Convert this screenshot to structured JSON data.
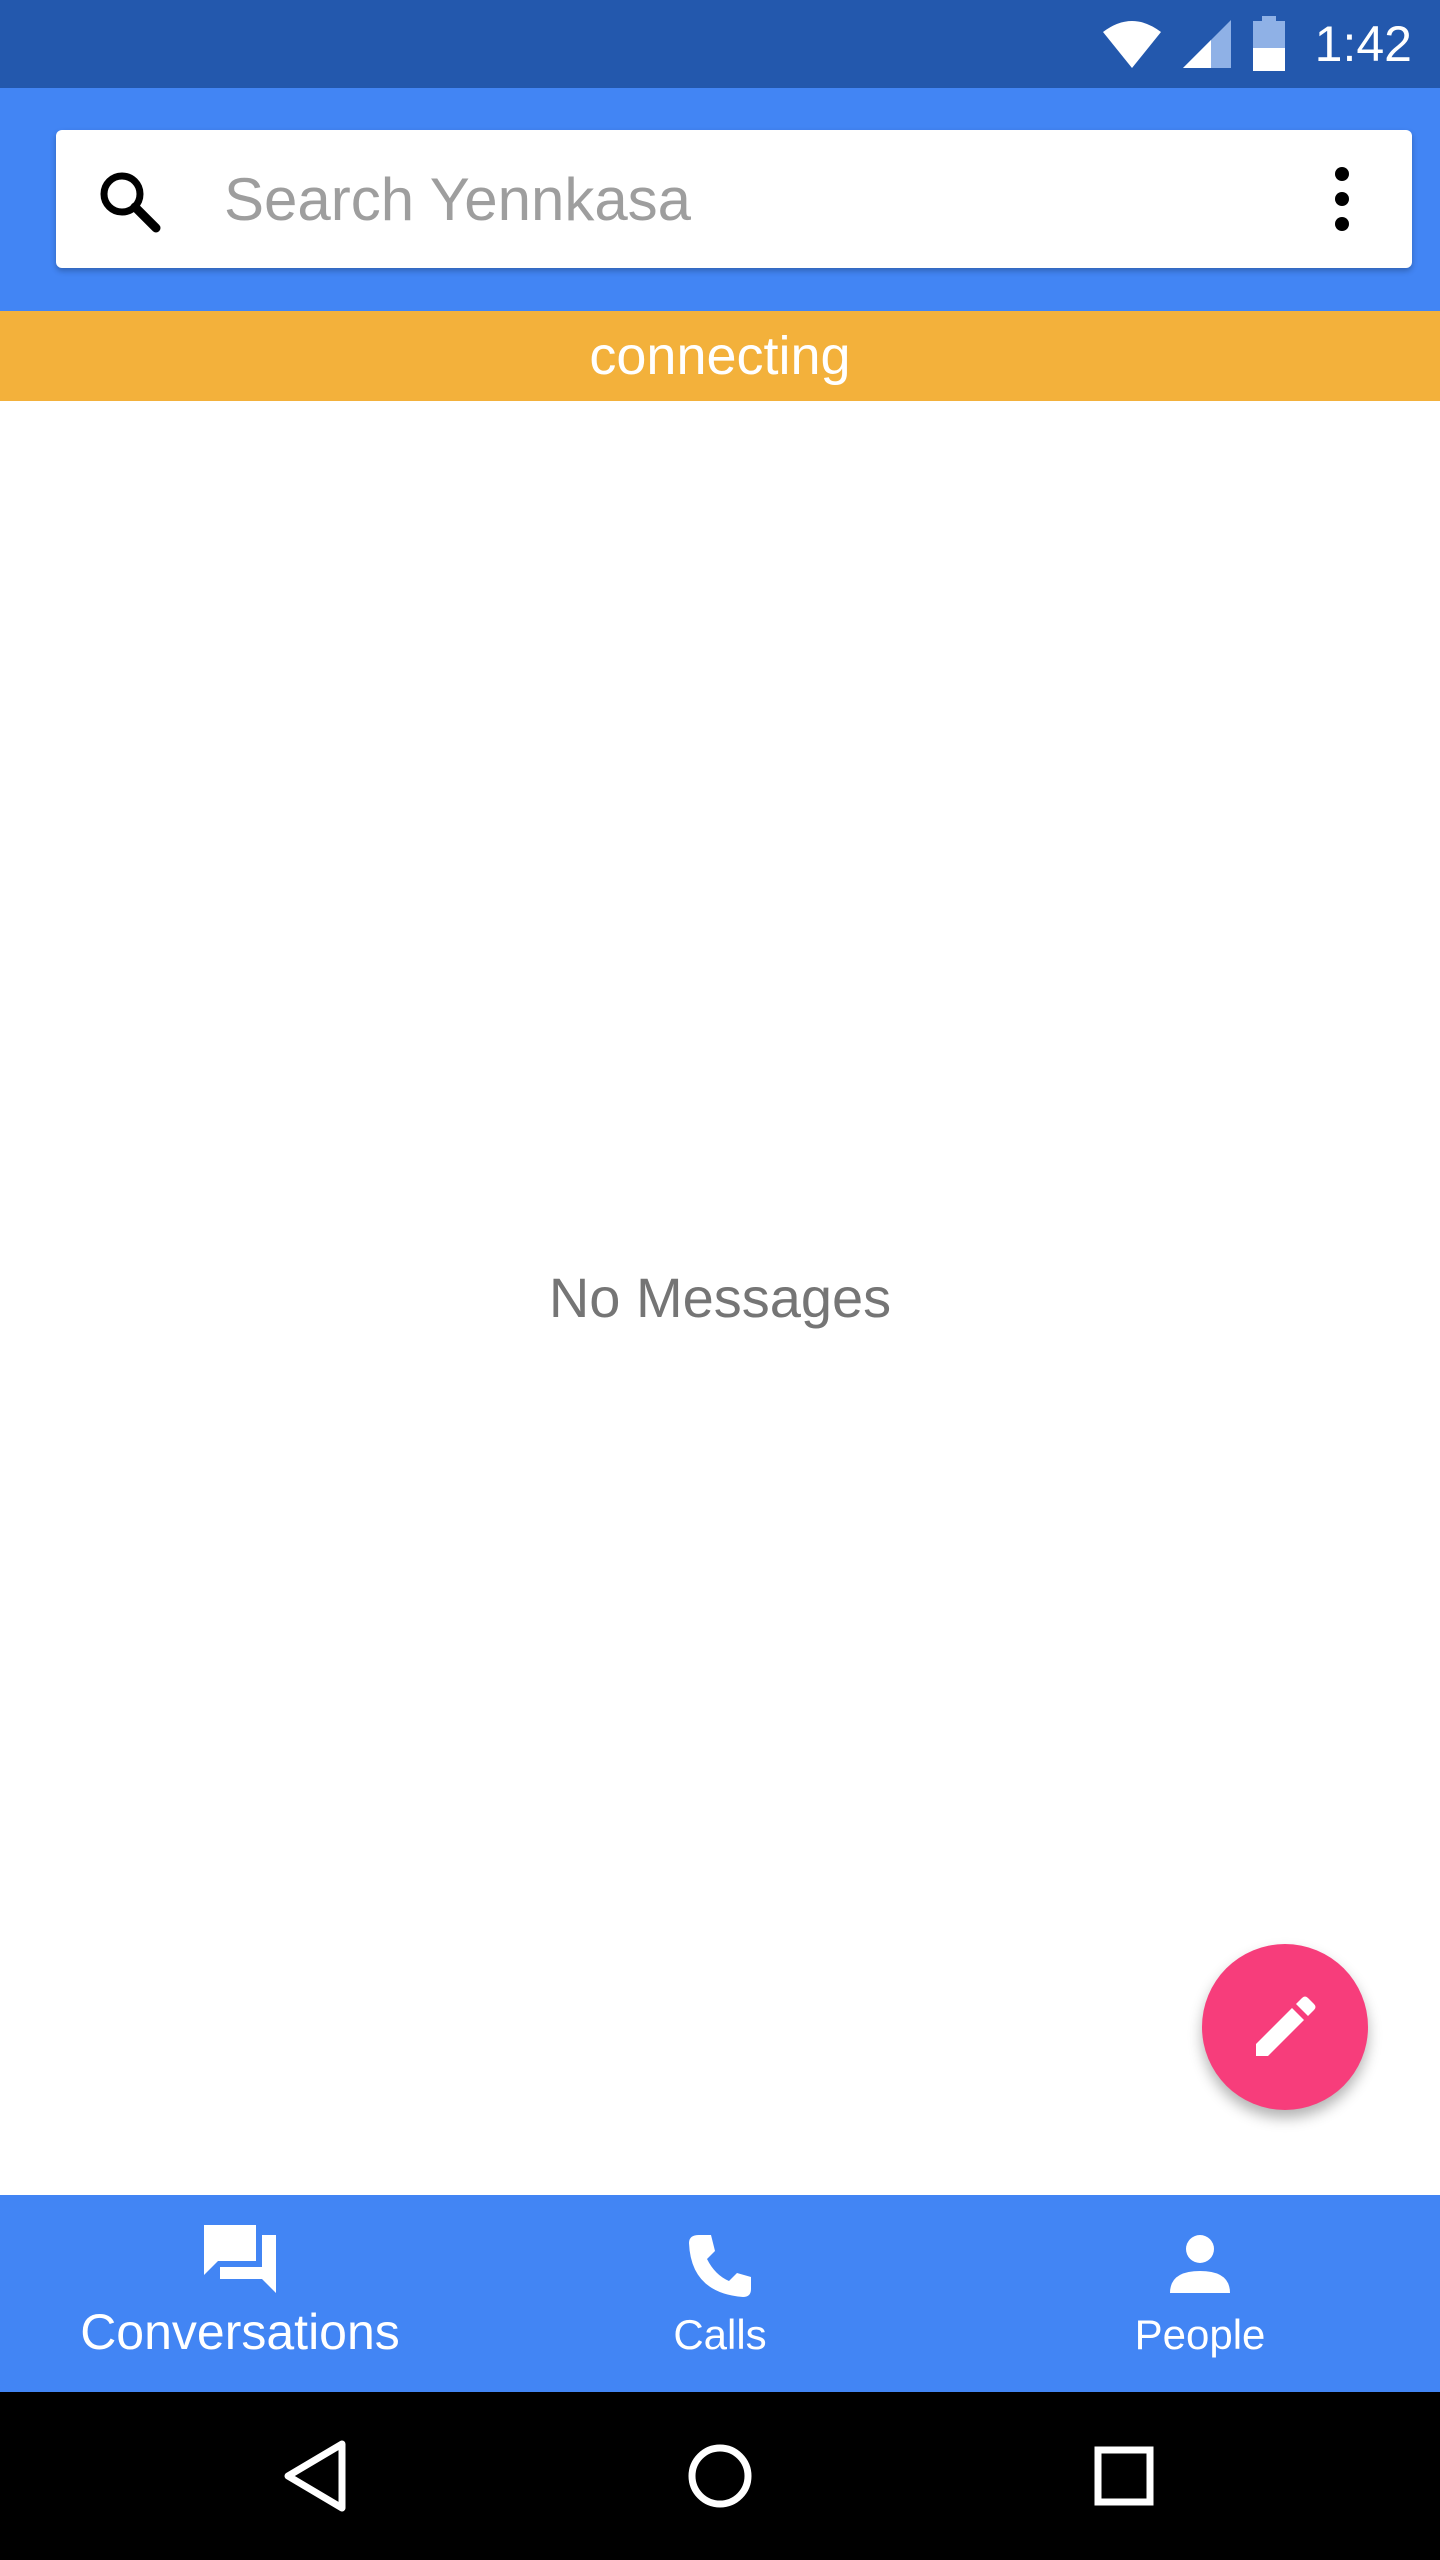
{
  "status_bar": {
    "time": "1:42",
    "icons": [
      "wifi-icon",
      "cell-signal-icon",
      "battery-icon"
    ]
  },
  "search": {
    "placeholder": "Search Yennkasa",
    "value": ""
  },
  "connection_status": "connecting",
  "main": {
    "empty_text": "No Messages"
  },
  "fab": {
    "icon": "pencil-icon"
  },
  "bottom_nav": {
    "items": [
      {
        "label": "Conversations",
        "icon": "chat-icon",
        "active": true
      },
      {
        "label": "Calls",
        "icon": "phone-icon",
        "active": false
      },
      {
        "label": "People",
        "icon": "person-icon",
        "active": false
      }
    ]
  },
  "system_nav": [
    "back-icon",
    "home-icon",
    "recents-icon"
  ],
  "colors": {
    "status_bar": "#2358ad",
    "primary": "#4285f4",
    "connecting": "#f3b13b",
    "fab": "#f73d7b"
  }
}
